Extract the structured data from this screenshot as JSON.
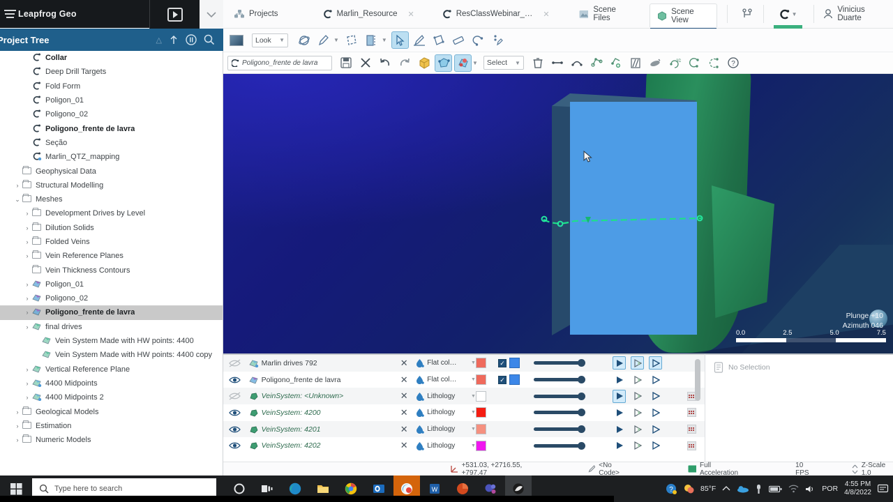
{
  "window": {
    "app_title": "Leapfrog Geo",
    "hamburger_icon": "hamburger-menu-icon",
    "play_icon": "play-button-icon",
    "chevron_icon": "chevron-down-icon"
  },
  "project_tree": {
    "title": "Project Tree",
    "header_icons": [
      "warning-icon",
      "upload-arrow-icon",
      "pause-icon",
      "search-icon"
    ],
    "items": [
      {
        "label": "Collar",
        "icon": "drillhole-icon",
        "indent": 2,
        "arrow": "",
        "bold": true,
        "selected": false
      },
      {
        "label": "Deep Drill Targets",
        "icon": "drillhole-icon",
        "indent": 2,
        "arrow": "",
        "bold": false,
        "selected": false
      },
      {
        "label": "Fold Form",
        "icon": "drillhole-icon",
        "indent": 2,
        "arrow": "",
        "bold": false,
        "selected": false
      },
      {
        "label": "Poligon_01",
        "icon": "drillhole-icon",
        "indent": 2,
        "arrow": "",
        "bold": false,
        "selected": false
      },
      {
        "label": "Poligono_02",
        "icon": "drillhole-icon",
        "indent": 2,
        "arrow": "",
        "bold": false,
        "selected": false
      },
      {
        "label": "Poligono_frente de lavra",
        "icon": "drillhole-icon",
        "indent": 2,
        "arrow": "",
        "bold": true,
        "selected": false
      },
      {
        "label": "Seção",
        "icon": "drillhole-icon",
        "indent": 2,
        "arrow": "",
        "bold": false,
        "selected": false
      },
      {
        "label": "Marlin_QTZ_mapping",
        "icon": "drillhole-gear-icon",
        "indent": 2,
        "arrow": "",
        "bold": false,
        "selected": false
      },
      {
        "label": "Geophysical Data",
        "icon": "folder-icon",
        "indent": 1,
        "arrow": "",
        "bold": false,
        "selected": false
      },
      {
        "label": "Structural Modelling",
        "icon": "folder-icon",
        "indent": 1,
        "arrow": "›",
        "bold": false,
        "selected": false
      },
      {
        "label": "Meshes",
        "icon": "folder-icon",
        "indent": 1,
        "arrow": "⌄",
        "bold": false,
        "selected": false
      },
      {
        "label": "Development Drives by Level",
        "icon": "folder-icon",
        "indent": 2,
        "arrow": "›",
        "bold": false,
        "selected": false
      },
      {
        "label": "Dilution Solids",
        "icon": "folder-icon",
        "indent": 2,
        "arrow": "›",
        "bold": false,
        "selected": false
      },
      {
        "label": "Folded Veins",
        "icon": "folder-icon",
        "indent": 2,
        "arrow": "›",
        "bold": false,
        "selected": false
      },
      {
        "label": "Vein Reference Planes",
        "icon": "folder-icon",
        "indent": 2,
        "arrow": "›",
        "bold": false,
        "selected": false
      },
      {
        "label": "Vein Thickness Contours",
        "icon": "folder-icon",
        "indent": 2,
        "arrow": "",
        "bold": false,
        "selected": false
      },
      {
        "label": "Poligon_01",
        "icon": "mesh-purple-icon",
        "indent": 2,
        "arrow": "›",
        "bold": false,
        "selected": false
      },
      {
        "label": "Poligono_02",
        "icon": "mesh-purple-icon",
        "indent": 2,
        "arrow": "›",
        "bold": false,
        "selected": false
      },
      {
        "label": "Poligono_frente de lavra",
        "icon": "mesh-purple-icon",
        "indent": 2,
        "arrow": "›",
        "bold": true,
        "selected": true
      },
      {
        "label": "final drives",
        "icon": "mesh-green-icon",
        "indent": 2,
        "arrow": "›",
        "bold": false,
        "selected": false
      },
      {
        "label": "Vein System Made with HW points: 4400",
        "icon": "mesh-green-icon",
        "indent": 3,
        "arrow": "",
        "bold": false,
        "selected": false
      },
      {
        "label": "Vein System Made with HW points: 4400 copy",
        "icon": "mesh-green-icon",
        "indent": 3,
        "arrow": "",
        "bold": false,
        "selected": false
      },
      {
        "label": "Vertical Reference Plane",
        "icon": "mesh-green-icon",
        "indent": 2,
        "arrow": "›",
        "bold": false,
        "selected": false
      },
      {
        "label": "4400 Midpoints",
        "icon": "mesh-gear-icon",
        "indent": 2,
        "arrow": "›",
        "bold": false,
        "selected": false
      },
      {
        "label": "4400 Midpoints 2",
        "icon": "mesh-gear-icon",
        "indent": 2,
        "arrow": "›",
        "bold": false,
        "selected": false
      },
      {
        "label": "Geological Models",
        "icon": "folder-icon",
        "indent": 1,
        "arrow": "›",
        "bold": false,
        "selected": false
      },
      {
        "label": "Estimation",
        "icon": "folder-icon",
        "indent": 1,
        "arrow": "›",
        "bold": false,
        "selected": false
      },
      {
        "label": "Numeric Models",
        "icon": "folder-icon",
        "indent": 1,
        "arrow": "›",
        "bold": false,
        "selected": false
      }
    ]
  },
  "ribbon_tabs": [
    {
      "label": "Projects",
      "icon": "projects-icon",
      "closable": false,
      "active": false
    },
    {
      "label": "Marlin_Resource",
      "icon": "project-c-icon",
      "closable": true,
      "active": false
    },
    {
      "label": "ResClassWebinar_…",
      "icon": "project-c-icon",
      "closable": true,
      "active": false
    },
    {
      "label": "Scene Files",
      "icon": "scene-files-icon",
      "closable": false,
      "active": false
    },
    {
      "label": "Scene View",
      "icon": "scene-view-icon",
      "closable": false,
      "active": true
    }
  ],
  "ribbon_right": {
    "branch_icon": "branch-icon",
    "central_icon": "central-c-icon",
    "central_chevron": "chevron-down-icon",
    "user_icon": "user-avatar-icon",
    "user_name": "Vinicius Duarte"
  },
  "toolbar_view": {
    "thumbnail_icon": "scene-thumbnail-icon",
    "look_label": "Look",
    "look_chevron": "chevron-down-icon",
    "tools": [
      {
        "icon": "orbit-icon",
        "active": false
      },
      {
        "icon": "measure-pen-icon",
        "active": false,
        "chevron": true
      },
      {
        "icon": "clipping-icon",
        "active": false
      },
      {
        "icon": "slicer-icon",
        "active": false,
        "chevron": true
      },
      {
        "icon": "select-pointer-icon",
        "active": true
      },
      {
        "icon": "draw-line-icon",
        "active": false
      },
      {
        "icon": "polygon-icon",
        "active": false
      },
      {
        "icon": "ruler-icon",
        "active": false
      },
      {
        "icon": "lasso-icon",
        "active": false
      },
      {
        "icon": "pin-icon",
        "active": false
      }
    ],
    "camera_icon": "camera-icon"
  },
  "toolbar_edit": {
    "object_name": "Poligono_frente de lavra",
    "object_icon": "drillhole-icon",
    "tools": [
      {
        "icon": "save-icon",
        "active": false
      },
      {
        "icon": "close-x-icon",
        "active": false
      },
      {
        "icon": "undo-icon",
        "active": false
      },
      {
        "icon": "redo-icon",
        "active": false
      },
      {
        "icon": "box-yellow-icon",
        "active": false
      },
      {
        "icon": "polyline-blue-icon",
        "active": true
      },
      {
        "icon": "node-edit-icon",
        "active": true,
        "chevron": true
      }
    ],
    "select_label": "Select",
    "select_chevron": "chevron-down-icon",
    "tools2": [
      {
        "icon": "trash-icon"
      },
      {
        "icon": "straight-segment-icon"
      },
      {
        "icon": "curved-segment-icon"
      },
      {
        "icon": "add-node-icon"
      },
      {
        "icon": "node-plus-icon"
      },
      {
        "icon": "split-icon"
      },
      {
        "icon": "surface-icon"
      },
      {
        "icon": "rotate-3d-icon"
      },
      {
        "icon": "arc-icon"
      },
      {
        "icon": "points-icon"
      },
      {
        "icon": "help-icon"
      }
    ]
  },
  "viewport": {
    "plunge_label": "Plunge +10",
    "azimuth_label": "Azimuth 046",
    "globe_icon": "orientation-globe-icon",
    "scale_ticks": [
      "0.0",
      "2.5",
      "5.0",
      "7.5"
    ],
    "cursor_icon": "mouse-pointer-icon"
  },
  "shape_list": {
    "columns": [
      "visibility",
      "icon",
      "name",
      "remove",
      "colour_by",
      "swatch",
      "legend",
      "opacity",
      "render",
      "more"
    ],
    "rows": [
      {
        "name": "Marlin drives 792",
        "icon": "mesh-gear-icon",
        "italic": false,
        "visible": false,
        "colour_by": "Flat col…",
        "swatch": "#ef6a5c",
        "checkbox": true,
        "checkbox_swatch": "#3c87e8",
        "opacity": 100,
        "tri_states": [
          true,
          true,
          true
        ],
        "more": false
      },
      {
        "name": "Poligono_frente de lavra",
        "icon": "mesh-purple-icon",
        "italic": false,
        "visible": true,
        "colour_by": "Flat col…",
        "swatch": "#ef6a5c",
        "checkbox": true,
        "checkbox_swatch": "#3c87e8",
        "opacity": 100,
        "tri_states": [
          false,
          false,
          false
        ],
        "more": false
      },
      {
        "name": "VeinSystem: <Unknown>",
        "icon": "vein-green-icon",
        "italic": true,
        "visible": false,
        "colour_by": "Lithology",
        "swatch": "#ffffff",
        "checkbox": false,
        "checkbox_swatch": "",
        "opacity": 100,
        "tri_states": [
          true,
          false,
          false
        ],
        "more": true
      },
      {
        "name": "VeinSystem: 4200",
        "icon": "vein-green-icon",
        "italic": true,
        "visible": true,
        "colour_by": "Lithology",
        "swatch": "#f51d12",
        "checkbox": false,
        "checkbox_swatch": "",
        "opacity": 100,
        "tri_states": [
          false,
          false,
          false
        ],
        "more": true
      },
      {
        "name": "VeinSystem: 4201",
        "icon": "vein-green-icon",
        "italic": true,
        "visible": true,
        "colour_by": "Lithology",
        "swatch": "#f59180",
        "checkbox": false,
        "checkbox_swatch": "",
        "opacity": 100,
        "tri_states": [
          false,
          false,
          false
        ],
        "more": true
      },
      {
        "name": "VeinSystem: 4202",
        "icon": "vein-green-icon",
        "italic": true,
        "visible": true,
        "colour_by": "Lithology",
        "swatch": "#f017ef",
        "checkbox": false,
        "checkbox_swatch": "",
        "opacity": 100,
        "tri_states": [
          false,
          false,
          false
        ],
        "more": true
      }
    ]
  },
  "properties": {
    "empty_label": "No Selection",
    "empty_icon": "document-icon"
  },
  "status_bar": {
    "coords_icon": "axes-icon",
    "coords": "+531.03, +2716.55, +797.47",
    "code_icon": "pen-icon",
    "code": "<No Code>",
    "accel_icon": "gpu-icon",
    "acceleration": "Full Acceleration",
    "fps": "10 FPS",
    "zscale_icon": "updown-arrow-icon",
    "zscale": "Z-Scale 1.0"
  },
  "taskbar": {
    "start_icon": "windows-start-icon",
    "search_icon": "search-icon",
    "search_placeholder": "Type here to search",
    "apps": [
      {
        "icon": "cortana-circle-icon",
        "active": false,
        "running": false
      },
      {
        "icon": "task-view-icon",
        "active": false,
        "running": false
      },
      {
        "icon": "edge-icon",
        "active": false,
        "running": true
      },
      {
        "icon": "file-explorer-icon",
        "active": false,
        "running": true
      },
      {
        "icon": "chrome-icon",
        "active": false,
        "running": true
      },
      {
        "icon": "outlook-icon",
        "active": false,
        "running": true
      },
      {
        "icon": "leapfrog-icon",
        "active": true,
        "running": true
      },
      {
        "icon": "word-icon",
        "active": false,
        "running": true
      },
      {
        "icon": "powerpoint-icon",
        "active": false,
        "running": true
      },
      {
        "icon": "teams-icon",
        "active": false,
        "running": true
      },
      {
        "icon": "camtasia-icon",
        "active": false,
        "running": true
      }
    ],
    "tray": {
      "help_icon": "help-circle-icon",
      "weather_icon": "weather-sun-icon",
      "temperature": "85°F",
      "chevron_icon": "chevron-up-icon",
      "onedrive_icon": "onedrive-icon",
      "usb_icon": "usb-icon",
      "battery_icon": "battery-icon",
      "wifi_icon": "wifi-icon",
      "volume_icon": "volume-icon",
      "language": "POR",
      "time": "4:55 PM",
      "date": "4/8/2022",
      "notification_icon": "notification-icon"
    }
  }
}
